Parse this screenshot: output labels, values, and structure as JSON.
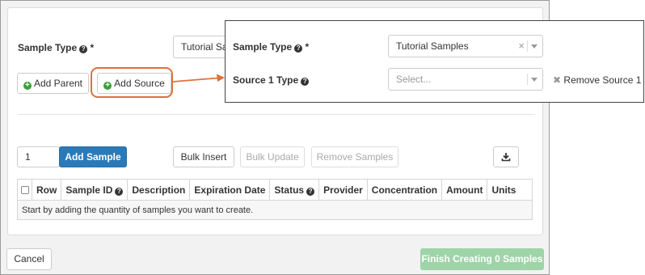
{
  "sample_type": {
    "label": "Sample Type",
    "required": "*",
    "value": "Tutorial Sam"
  },
  "buttons": {
    "add_parent": "Add Parent",
    "add_source": "Add Source",
    "add_sample": "Add Sample",
    "bulk_insert": "Bulk Insert",
    "bulk_update": "Bulk Update",
    "remove_samples": "Remove Samples",
    "cancel": "Cancel",
    "finish": "Finish Creating 0 Samples"
  },
  "quantity": {
    "value": "1"
  },
  "grid": {
    "columns": [
      "Row",
      "Sample ID",
      "Description",
      "Expiration Date",
      "Status",
      "Provider",
      "Concentration",
      "Amount",
      "Units"
    ],
    "empty_message": "Start by adding the quantity of samples you want to create."
  },
  "popout": {
    "sample_type_label": "Sample Type",
    "required": "*",
    "sample_type_value": "Tutorial Samples",
    "source_label": "Source 1 Type",
    "source_placeholder": "Select...",
    "remove_source": "Remove Source 1"
  },
  "colors": {
    "primary": "#2a7ab9",
    "success": "#3b9e3b",
    "finish_disabled": "#9fd3a8",
    "highlight": "#e0703a"
  }
}
